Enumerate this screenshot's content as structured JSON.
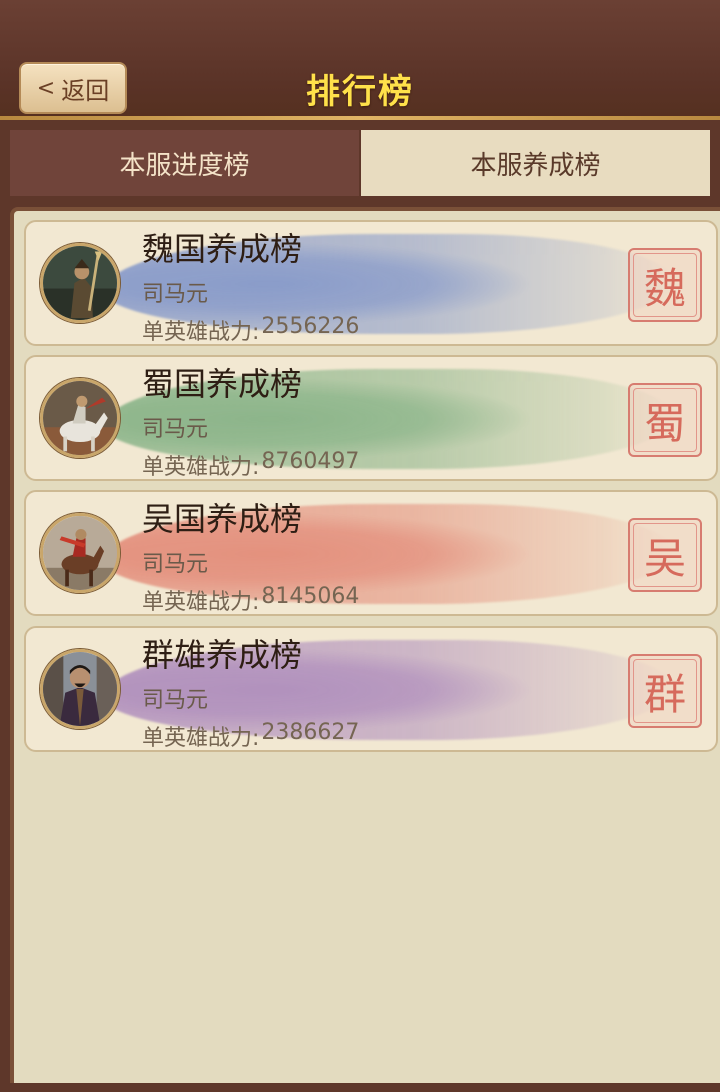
{
  "header": {
    "back_label": "返回",
    "back_chevron": "<",
    "title": "排行榜"
  },
  "tabs": [
    {
      "label": "本服进度榜",
      "active": false
    },
    {
      "label": "本服养成榜",
      "active": true
    }
  ],
  "rankings": [
    {
      "title": "魏国养成榜",
      "player": "司马元",
      "power_label": "单英雄战力:",
      "power_value": "2556226",
      "seal": "魏",
      "brush_color": "#6f88c8",
      "avatar_icon": "general-with-halberd-icon"
    },
    {
      "title": "蜀国养成榜",
      "player": "司马元",
      "power_label": "单英雄战力:",
      "power_value": "8760497",
      "seal": "蜀",
      "brush_color": "#72a878",
      "avatar_icon": "knight-on-white-horse-icon"
    },
    {
      "title": "吴国养成榜",
      "player": "司马元",
      "power_label": "单英雄战力:",
      "power_value": "8145064",
      "seal": "吴",
      "brush_color": "#e07a68",
      "avatar_icon": "rider-on-brown-horse-icon"
    },
    {
      "title": "群雄养成榜",
      "player": "司马元",
      "power_label": "单英雄战力:",
      "power_value": "2386627",
      "seal": "群",
      "brush_color": "#a07ab8",
      "avatar_icon": "warlord-in-robe-icon"
    }
  ]
}
